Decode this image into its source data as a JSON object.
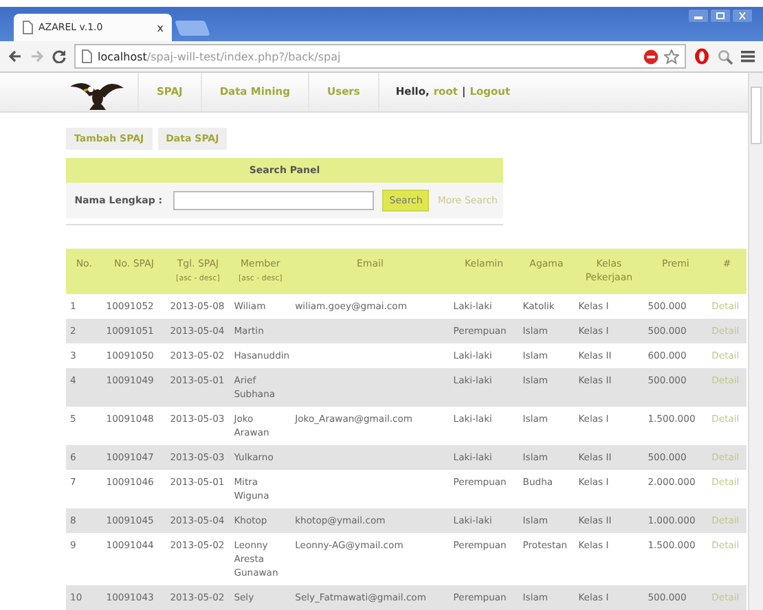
{
  "browser": {
    "tabs": [
      {
        "title": "AZAREL v.1.0",
        "selected": true
      }
    ],
    "close_tab": "x",
    "address": "**localhost**/spaj-will-test/index.php?/back/spaj"
  },
  "nav": {
    "items": [
      {
        "label": "SPAJ"
      },
      {
        "label": "Data Mining"
      },
      {
        "label": "Users"
      }
    ],
    "greeting": "Hello,",
    "user": "root",
    "separator": "|",
    "logout": "Logout"
  },
  "subnav": [
    "Tambah SPAJ",
    "Data SPAJ"
  ],
  "search_panel": {
    "title": "Search Panel",
    "label": "Nama Lengkap :",
    "button": "Search",
    "link": "More Search"
  },
  "table": {
    "columns": [
      {
        "label": "No."
      },
      {
        "label": "No. SPAJ"
      },
      {
        "label": "Tgl. SPAJ",
        "sort": "[asc - desc]"
      },
      {
        "label": "Member",
        "sort": "[asc - desc]"
      },
      {
        "label": "Email"
      },
      {
        "label": "Kelamin"
      },
      {
        "label": "Agama"
      },
      {
        "label": "Kelas Pekerjaan"
      },
      {
        "label": "Premi"
      },
      {
        "label": "#"
      }
    ],
    "rows": [
      [
        "1",
        "10091052",
        "2013-05-08",
        "Wiliam",
        "wiliam.goey@gmai.com",
        "Laki-laki",
        "Katolik",
        "Kelas I",
        "500.000",
        "Detail"
      ],
      [
        "2",
        "10091051",
        "2013-05-04",
        "Martin",
        "",
        "Perempuan",
        "Islam",
        "Kelas I",
        "500.000",
        "Detail"
      ],
      [
        "3",
        "10091050",
        "2013-05-02",
        "Hasanuddin",
        "",
        "Laki-laki",
        "Islam",
        "Kelas II",
        "600.000",
        "Detail"
      ],
      [
        "4",
        "10091049",
        "2013-05-01",
        "Arief Subhana",
        "",
        "Laki-laki",
        "Islam",
        "Kelas II",
        "500.000",
        "Detail"
      ],
      [
        "5",
        "10091048",
        "2013-05-03",
        "Joko Arawan",
        "Joko_Arawan@gmail.com",
        "Laki-laki",
        "Islam",
        "Kelas I",
        "1.500.000",
        "Detail"
      ],
      [
        "6",
        "10091047",
        "2013-05-03",
        "Yulkarno",
        "",
        "Laki-laki",
        "Islam",
        "Kelas II",
        "500.000",
        "Detail"
      ],
      [
        "7",
        "10091046",
        "2013-05-01",
        "Mitra Wiguna",
        "",
        "Perempuan",
        "Budha",
        "Kelas I",
        "2.000.000",
        "Detail"
      ],
      [
        "8",
        "10091045",
        "2013-05-04",
        "Khotop",
        "khotop@ymail.com",
        "Laki-laki",
        "Islam",
        "Kelas II",
        "1.000.000",
        "Detail"
      ],
      [
        "9",
        "10091044",
        "2013-05-02",
        "Leonny Aresta Gunawan",
        "Leonny-AG@ymail.com",
        "Perempuan",
        "Protestan",
        "Kelas I",
        "1.500.000",
        "Detail"
      ],
      [
        "10",
        "10091043",
        "2013-05-02",
        "Sely",
        "Sely_Fatmawati@gmail.com",
        "Perempuan",
        "Islam",
        "Kelas I",
        "500.000",
        "Detail"
      ]
    ]
  }
}
